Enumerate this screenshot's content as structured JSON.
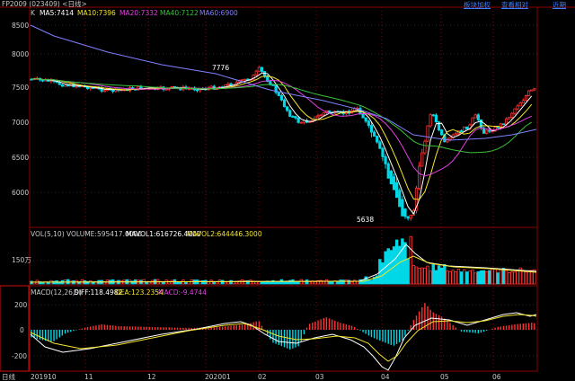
{
  "window": {
    "title": "FP2009 (023409) <日线>",
    "links": [
      "板块加权",
      "查看相对",
      "近期"
    ]
  },
  "legends": {
    "price": [
      {
        "text": "K",
        "color": "#c8c8c8"
      },
      {
        "text": "MA5:7414",
        "color": "#ffffff"
      },
      {
        "text": "MA10:7396",
        "color": "#f5e52a"
      },
      {
        "text": "MA20:7332",
        "color": "#e040e0"
      },
      {
        "text": "MA40:7122",
        "color": "#3ac23a"
      },
      {
        "text": "MA60:6900",
        "color": "#8080ff"
      }
    ],
    "volume": [
      {
        "text": "VOL(5,10) VOLUME:595417.0000",
        "color": "#c8c8c8"
      },
      {
        "text": "MAVOL1:616726.4000",
        "color": "#ffffff"
      },
      {
        "text": "MAVOL2:644446.3000",
        "color": "#f5e52a"
      }
    ],
    "macd": [
      {
        "text": "MACD(12,26,9)",
        "color": "#c8c8c8"
      },
      {
        "text": "DIFF:118.4982",
        "color": "#ffffff"
      },
      {
        "text": "DEA:123.2354",
        "color": "#f5e52a"
      },
      {
        "text": "MACD:-9.4744",
        "color": "#e040e0"
      }
    ]
  },
  "axis": {
    "price_labels": [
      "8500",
      "8000",
      "7500",
      "7000",
      "6500",
      "6000"
    ],
    "volume_label": "150万",
    "macd_labels": [
      "200",
      "0",
      "-200"
    ],
    "date_labels": [
      "201910",
      "11",
      "12",
      "202001",
      "02",
      "03",
      "04",
      "05",
      "06"
    ],
    "corner_label": "日线"
  },
  "annotations": {
    "high": "7776",
    "low": "5638"
  },
  "colors": {
    "up": "#ff3232",
    "down": "#00d8e8",
    "grid": "#8b0000"
  }
}
